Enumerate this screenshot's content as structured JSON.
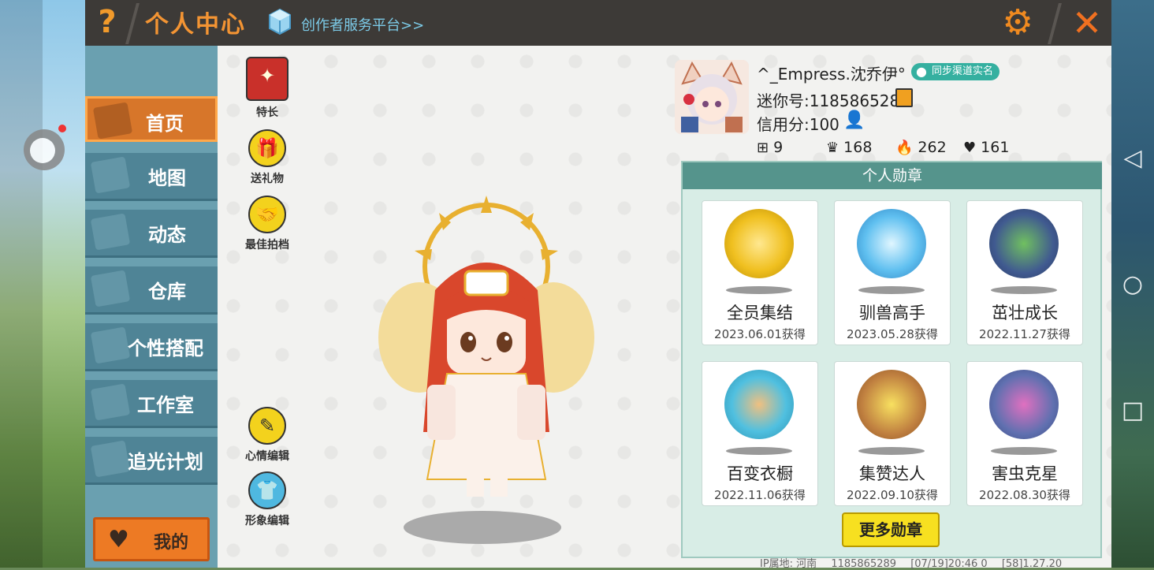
{
  "header": {
    "title": "个人中心",
    "creator_link": "创作者服务平台>>"
  },
  "sidebar": {
    "items": [
      {
        "label": "首页",
        "icon": "home-icon",
        "active": true
      },
      {
        "label": "地图",
        "icon": "map-icon",
        "active": false
      },
      {
        "label": "动态",
        "icon": "bell-icon",
        "active": false
      },
      {
        "label": "仓库",
        "icon": "warehouse-icon",
        "active": false
      },
      {
        "label": "个性搭配",
        "icon": "outfit-icon",
        "active": false
      },
      {
        "label": "工作室",
        "icon": "studio-icon",
        "active": false
      },
      {
        "label": "追光计划",
        "icon": "plan-icon",
        "active": false
      }
    ],
    "me_button": "我的"
  },
  "actions": {
    "talent": "特长",
    "gift": "送礼物",
    "partner": "最佳拍档",
    "mood": "心情编辑",
    "appearance": "形象编辑"
  },
  "profile": {
    "username": "^_Empress.沈乔伊°",
    "realname_badge": "同步渠道实名",
    "mini_id": "迷你号:1185865289",
    "credit": "信用分:100",
    "stats": {
      "friends": "9",
      "likes": "168",
      "popularity": "262",
      "hearts": "161"
    }
  },
  "medals": {
    "title": "个人勋章",
    "items": [
      {
        "name": "全员集结",
        "date": "2023.06.01获得",
        "color": "#f0c020"
      },
      {
        "name": "驯兽高手",
        "date": "2023.05.28获得",
        "color": "#60c0f0"
      },
      {
        "name": "茁壮成长",
        "date": "2022.11.27获得",
        "color": "#405a90"
      },
      {
        "name": "百变衣橱",
        "date": "2022.11.06获得",
        "color": "#50c0e0"
      },
      {
        "name": "集赞达人",
        "date": "2022.09.10获得",
        "color": "#c08040"
      },
      {
        "name": "害虫克星",
        "date": "2022.08.30获得",
        "color": "#6070b0"
      }
    ],
    "more_button": "更多勋章"
  },
  "footer": {
    "ip": "IP属地: 河南",
    "uid": "1185865289",
    "time": "[07/19]20:46 0",
    "version": "[58]1.27.20"
  },
  "colors": {
    "accent": "#f39433",
    "header_bg": "#3d3a37",
    "sidebar_bg": "#4f8496",
    "active_tab": "#d7762a",
    "medals_header": "#55948c"
  }
}
